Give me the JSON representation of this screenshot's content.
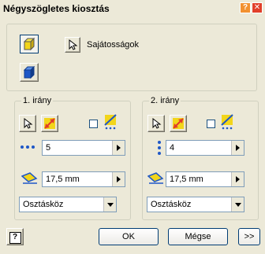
{
  "window": {
    "title": "Négyszögletes kiosztás",
    "help_glyph": "?",
    "close_glyph": "✕"
  },
  "top": {
    "properties_label": "Sajátosságok"
  },
  "direction1": {
    "label": "1. irány",
    "count_value": "5",
    "spacing_value": "17,5 mm",
    "method_value": "Osztásköz"
  },
  "direction2": {
    "label": "2. irány",
    "count_value": "4",
    "spacing_value": "17,5 mm",
    "method_value": "Osztásköz"
  },
  "footer": {
    "help_label": "?",
    "ok_label": "OK",
    "cancel_label": "Mégse",
    "more_label": ">>"
  },
  "colors": {
    "window_bg": "#ece9d8",
    "accent_blue": "#003c74",
    "icon_yellow": "#f2d51a",
    "icon_red": "#e23a2a",
    "icon_blue": "#1e57c7"
  }
}
